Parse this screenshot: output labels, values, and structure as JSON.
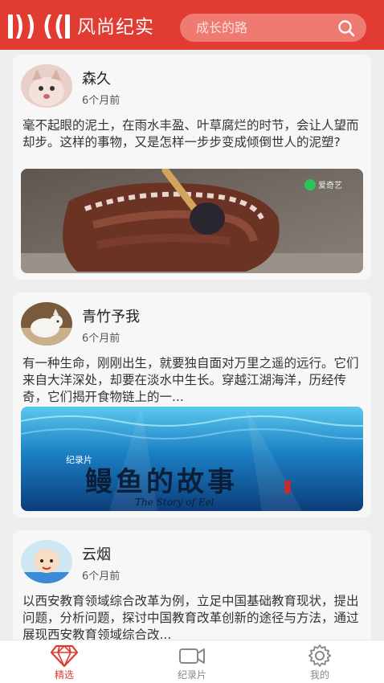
{
  "header": {
    "title": "风尚纪实",
    "search_placeholder": "成长的路"
  },
  "posts": [
    {
      "author": "森久",
      "time": "6个月前",
      "text": "毫不起眼的泥土，在雨水丰盈、叶草腐烂的时节，会让人望而却步。这样的事物，又是怎样一步步变成倾倒世人的泥塑?",
      "watermark": "爱奇艺"
    },
    {
      "author": "青竹予我",
      "time": "6个月前",
      "text": "有一种生命，刚刚出生，就要独自面对万里之遥的远行。它们来自大洋深处，却要在淡水中生长。穿越江湖海洋，历经传奇，它们揭开食物链上的一...",
      "thumb_tag": "纪录片",
      "thumb_title": "鳗鱼的故事",
      "thumb_subtitle": "The Story of Eel"
    },
    {
      "author": "云烟",
      "time": "6个月前",
      "text": "以西安教育领域综合改革为例，立足中国基础教育现状，提出问题，分析问题，探讨中国教育改革创新的途径与方法，通过展现西安教育领域综合改..."
    }
  ],
  "tabs": [
    {
      "label": "精选",
      "icon": "diamond-icon",
      "active": true
    },
    {
      "label": "纪录片",
      "icon": "video-camera-icon",
      "active": false
    },
    {
      "label": "我的",
      "icon": "gear-icon",
      "active": false
    }
  ],
  "colors": {
    "brand": "#e23c32",
    "tab_inactive": "#888888"
  }
}
